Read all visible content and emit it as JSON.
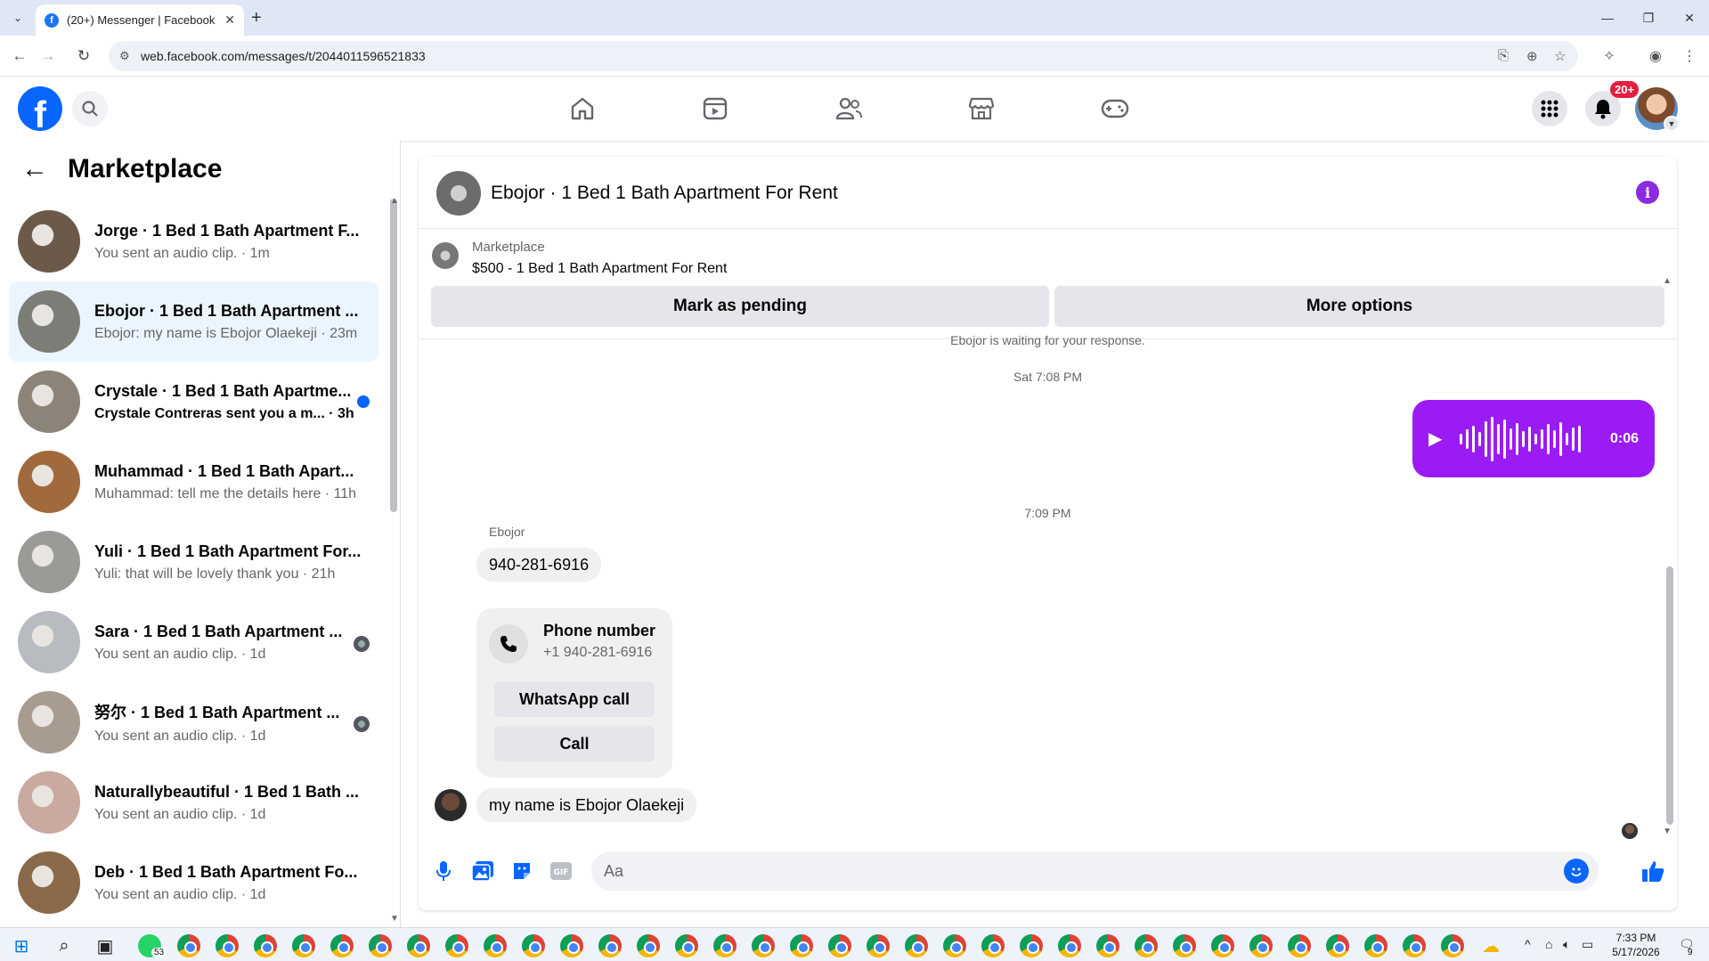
{
  "browser": {
    "tab_title": "(20+) Messenger | Facebook",
    "url": "web.facebook.com/messages/t/2044011596521833"
  },
  "header": {
    "notification_badge": "20+"
  },
  "sidebar": {
    "title": "Marketplace",
    "conversations": [
      {
        "name": "Jorge · 1 Bed 1 Bath Apartment F...",
        "preview": "You sent an audio clip. · 1m",
        "active": false,
        "unread": false,
        "meta": "none",
        "thumb_color": "#6b5a4a"
      },
      {
        "name": "Ebojor · 1 Bed 1 Bath Apartment ...",
        "preview": "Ebojor: my name is Ebojor Olaekeji · 23m",
        "active": true,
        "unread": false,
        "meta": "none",
        "thumb_color": "#7d7d78"
      },
      {
        "name": "Crystale · 1 Bed 1 Bath Apartme...",
        "preview": "Crystale Contreras sent you a m... · 3h",
        "active": false,
        "unread": true,
        "meta": "dot",
        "thumb_color": "#8c8478"
      },
      {
        "name": "Muhammad · 1 Bed 1 Bath Apart...",
        "preview": "Muhammad: tell me the details here · 11h",
        "active": false,
        "unread": false,
        "meta": "none",
        "thumb_color": "#a06a3e"
      },
      {
        "name": "Yuli · 1 Bed 1 Bath Apartment For...",
        "preview": "Yuli: that will be lovely thank you · 21h",
        "active": false,
        "unread": false,
        "meta": "none",
        "thumb_color": "#9a9a96"
      },
      {
        "name": "Sara · 1 Bed 1 Bath Apartment ...",
        "preview": "You sent an audio clip. · 1d",
        "active": false,
        "unread": false,
        "meta": "avatar",
        "thumb_color": "#b8bcc0"
      },
      {
        "name": "努尔 · 1 Bed 1 Bath Apartment ...",
        "preview": "You sent an audio clip. · 1d",
        "active": false,
        "unread": false,
        "meta": "avatar",
        "thumb_color": "#a89c90"
      },
      {
        "name": "Naturallybeautiful · 1 Bed 1 Bath ...",
        "preview": "You sent an audio clip. · 1d",
        "active": false,
        "unread": false,
        "meta": "none",
        "thumb_color": "#c9a9a0"
      },
      {
        "name": "Deb · 1 Bed 1 Bath Apartment Fo...",
        "preview": "You sent an audio clip. · 1d",
        "active": false,
        "unread": false,
        "meta": "none",
        "thumb_color": "#8a6a4a"
      }
    ]
  },
  "chat": {
    "title": "Ebojor · 1 Bed 1 Bath Apartment For Rent",
    "listing_source": "Marketplace",
    "listing_price": "$500 - 1 Bed 1 Bath Apartment For Rent",
    "mark_pending_label": "Mark as pending",
    "more_options_label": "More options",
    "waiting_text": "Ebojor is waiting for your response.",
    "timestamp_1": "Sat 7:08 PM",
    "audio_duration": "0:06",
    "timestamp_2": "7:09 PM",
    "sender_name": "Ebojor",
    "msg_phone": "940-281-6916",
    "phone_card_title": "Phone number",
    "phone_card_number": "+1 940-281-6916",
    "whatsapp_label": "WhatsApp call",
    "call_label": "Call",
    "msg_name": "my name is Ebojor Olaekeji",
    "composer_placeholder": "Aa"
  },
  "taskbar": {
    "whatsapp_badge": "53",
    "time": "7:33 PM",
    "date": "5/17/2026",
    "notif_count": "9"
  },
  "colors": {
    "fb_blue": "#0866ff",
    "messenger_purple": "#9b1bf5",
    "active_row": "#ebf5ff"
  }
}
